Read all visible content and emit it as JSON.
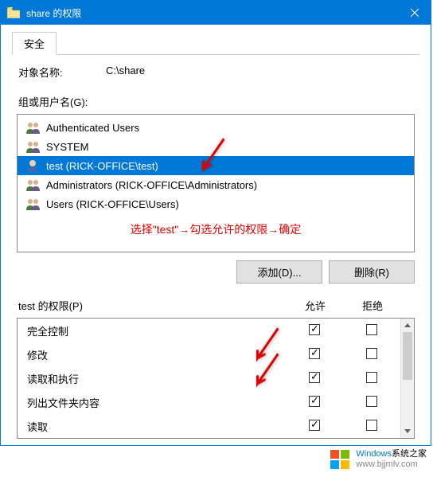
{
  "window": {
    "title": "share 的权限"
  },
  "tabs": {
    "security": "安全"
  },
  "object": {
    "label": "对象名称:",
    "value": "C:\\share"
  },
  "groups": {
    "label": "组或用户名(G):",
    "items": [
      {
        "name": "Authenticated Users",
        "selected": false
      },
      {
        "name": "SYSTEM",
        "selected": false
      },
      {
        "name": "test (RICK-OFFICE\\test)",
        "selected": true
      },
      {
        "name": "Administrators (RICK-OFFICE\\Administrators)",
        "selected": false
      },
      {
        "name": "Users (RICK-OFFICE\\Users)",
        "selected": false
      }
    ]
  },
  "annotation": "选择\"test\"→勾选允许的权限→确定",
  "buttons": {
    "add": "添加(D)...",
    "remove": "删除(R)"
  },
  "permissions": {
    "label": "test 的权限(P)",
    "col_allow": "允许",
    "col_deny": "拒绝",
    "items": [
      {
        "name": "完全控制",
        "allow": true,
        "deny": false
      },
      {
        "name": "修改",
        "allow": true,
        "deny": false
      },
      {
        "name": "读取和执行",
        "allow": true,
        "deny": false
      },
      {
        "name": "列出文件夹内容",
        "allow": true,
        "deny": false
      },
      {
        "name": "读取",
        "allow": true,
        "deny": false
      }
    ]
  },
  "watermark": {
    "brand_prefix": "Windows",
    "brand_suffix": "系统之家",
    "url": "www.bjjmlv.com"
  }
}
